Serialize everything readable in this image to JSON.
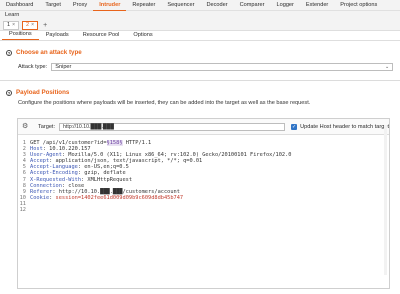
{
  "top_tabs": [
    "Dashboard",
    "Target",
    "Proxy",
    "Intruder",
    "Repeater",
    "Sequencer",
    "Decoder",
    "Comparer",
    "Logger",
    "Extender",
    "Project options"
  ],
  "active_top_tab": "Intruder",
  "learn_label": "Learn",
  "attack_tabs": [
    {
      "label": "1",
      "close": "×"
    },
    {
      "label": "2",
      "close": "×"
    }
  ],
  "add_tab": "+",
  "inner_tabs": [
    "Positions",
    "Payloads",
    "Resource Pool",
    "Options"
  ],
  "choose_section": {
    "title": "Choose an attack type",
    "attack_type_label": "Attack type:",
    "attack_type_value": "Sniper"
  },
  "payload_section": {
    "title": "Payload Positions",
    "description": "Configure the positions where payloads will be inserted, they can be added into the target as well as the base request."
  },
  "target": {
    "label": "Target:",
    "value": "http://10.10.███.███",
    "update_host_label": "Update Host header to match target",
    "update_host_checked": true
  },
  "request_lines": [
    {
      "n": "1",
      "parts": [
        {
          "t": "GET /api/v1/customer?id=",
          "c": "hv"
        },
        {
          "t": "§158§",
          "c": "pay"
        },
        {
          "t": " HTTP/1.1",
          "c": "hv"
        }
      ]
    },
    {
      "n": "2",
      "parts": [
        {
          "t": "Host",
          "c": "hk"
        },
        {
          "t": ": 10.10.220.157",
          "c": "hv"
        }
      ]
    },
    {
      "n": "3",
      "parts": [
        {
          "t": "User-Agent",
          "c": "hk"
        },
        {
          "t": ": Mozilla/5.0 (X11; Linux x86_64; rv:102.0) Gecko/20100101 Firefox/102.0",
          "c": "hv"
        }
      ]
    },
    {
      "n": "4",
      "parts": [
        {
          "t": "Accept",
          "c": "hk"
        },
        {
          "t": ": application/json, text/javascript, */*; q=0.01",
          "c": "hv"
        }
      ]
    },
    {
      "n": "5",
      "parts": [
        {
          "t": "Accept-Language",
          "c": "hk"
        },
        {
          "t": ": en-US,en;q=0.5",
          "c": "hv"
        }
      ]
    },
    {
      "n": "6",
      "parts": [
        {
          "t": "Accept-Encoding",
          "c": "hk"
        },
        {
          "t": ": gzip, deflate",
          "c": "hv"
        }
      ]
    },
    {
      "n": "7",
      "parts": [
        {
          "t": "X-Requested-With",
          "c": "hk"
        },
        {
          "t": ": XMLHttpRequest",
          "c": "hv"
        }
      ]
    },
    {
      "n": "8",
      "parts": [
        {
          "t": "Connection",
          "c": "hk"
        },
        {
          "t": ": close",
          "c": "hv"
        }
      ]
    },
    {
      "n": "9",
      "parts": [
        {
          "t": "Referer",
          "c": "hk"
        },
        {
          "t": ": http://10.10.███.███/customers/account",
          "c": "hv"
        }
      ]
    },
    {
      "n": "10",
      "parts": [
        {
          "t": "Cookie",
          "c": "ck"
        },
        {
          "t": ": ",
          "c": "hv"
        },
        {
          "t": "session=1402fee61d009d09b9c609d8db45b747",
          "c": "cv"
        }
      ]
    },
    {
      "n": "11",
      "parts": []
    },
    {
      "n": "12",
      "parts": []
    }
  ],
  "colors": {
    "accent": "#e8641b",
    "header_key": "#3a55b4",
    "cookie_value": "#c0392b",
    "checkbox": "#2f74c6"
  }
}
